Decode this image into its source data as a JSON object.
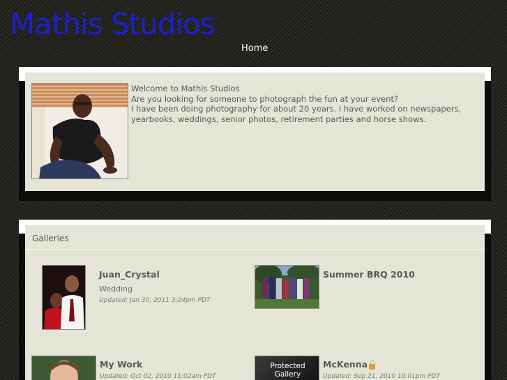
{
  "site": {
    "title": "Mathis Studios"
  },
  "nav": {
    "home": "Home"
  },
  "welcome": {
    "line1": "Welcome to Mathis Studios",
    "line2": "Are you looking for someone to photograph the fun at your event?",
    "line3": "I have been doing photography for about 20 years. I have worked on newspapers, yearbooks, weddings, senior photos, retirement parties and horse shows."
  },
  "galleries": {
    "header": "Galleries",
    "items": [
      {
        "title": "Juan_Crystal",
        "subtitle": "Wedding",
        "updated": "Updated: Jan 30, 2011 3:24pm PDT"
      },
      {
        "title": "Summer BRQ 2010"
      },
      {
        "title": "My Work",
        "updated": "Updated: Oct 02, 2010 11:02am PDT"
      },
      {
        "title": "McKenna",
        "updated": "Updated: Sep 21, 2010 10:01pm PDT",
        "thumb_label": "Protected Gallery",
        "icon": "lock-icon"
      }
    ]
  },
  "colors": {
    "title": "#1e1ed0",
    "panel": "#e4e5d7",
    "text": "#555a52"
  }
}
